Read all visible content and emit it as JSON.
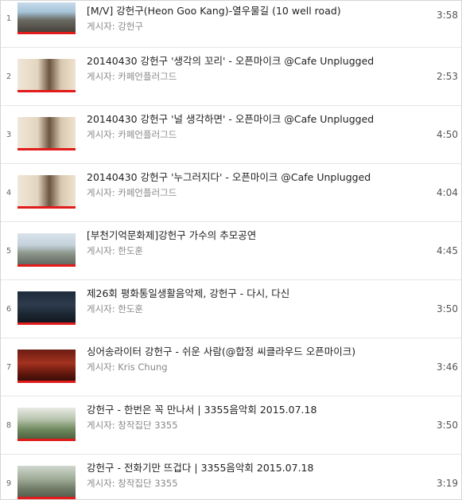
{
  "playlist": {
    "items": [
      {
        "index": "1",
        "title": "[M/V] 강헌구(Heon Goo Kang)-열우물길 (10 well road)",
        "uploader": "게시자: 강헌구",
        "duration": "3:58",
        "thumb": "t-street",
        "thumb_icon": "street-scene-thumbnail"
      },
      {
        "index": "2",
        "title": "20140430 강헌구 '생각의 꼬리' - 오픈마이크 @Cafe Unplugged",
        "uploader": "게시자: 카페언플러그드",
        "duration": "2:53",
        "thumb": "t-cafe",
        "thumb_icon": "guitarist-cafe-thumbnail"
      },
      {
        "index": "3",
        "title": "20140430 강헌구 '널 생각하면' - 오픈마이크 @Cafe Unplugged",
        "uploader": "게시자: 카페언플러그드",
        "duration": "4:50",
        "thumb": "t-cafe",
        "thumb_icon": "guitarist-cafe-thumbnail"
      },
      {
        "index": "4",
        "title": "20140430 강헌구 '누그러지다' - 오픈마이크 @Cafe Unplugged",
        "uploader": "게시자: 카페언플러그드",
        "duration": "4:04",
        "thumb": "t-cafe",
        "thumb_icon": "guitarist-cafe-thumbnail"
      },
      {
        "index": "5",
        "title": "[부천기억문화제]강헌구 가수의 추모공연",
        "uploader": "게시자: 한도훈",
        "duration": "4:45",
        "thumb": "t-outdoor",
        "thumb_icon": "outdoor-performance-thumbnail"
      },
      {
        "index": "6",
        "title": "제26회 평화통일생활음악제, 강헌구 - 다시, 다신",
        "uploader": "게시자: 한도훈",
        "duration": "3:50",
        "thumb": "t-stage",
        "thumb_icon": "stage-guitarist-thumbnail"
      },
      {
        "index": "7",
        "title": "싱어송라이터 강헌구 - 쉬운 사람(@합정 씨클라우드 오픈마이크)",
        "uploader": "게시자: Kris Chung",
        "duration": "3:46",
        "thumb": "t-red",
        "thumb_icon": "red-stage-thumbnail"
      },
      {
        "index": "8",
        "title": "강헌구 - 한번은 꼭 만나서 | 3355음악회 2015.07.18",
        "uploader": "게시자: 창작집단 3355",
        "duration": "3:50",
        "thumb": "t-green",
        "thumb_icon": "garden-thumbnail"
      },
      {
        "index": "9",
        "title": "강헌구 - 전화기만 뜨겁다 | 3355음악회 2015.07.18",
        "uploader": "게시자: 창작집단 3355",
        "duration": "3:19",
        "thumb": "t-grass",
        "thumb_icon": "outdoor-concert-thumbnail"
      }
    ]
  }
}
